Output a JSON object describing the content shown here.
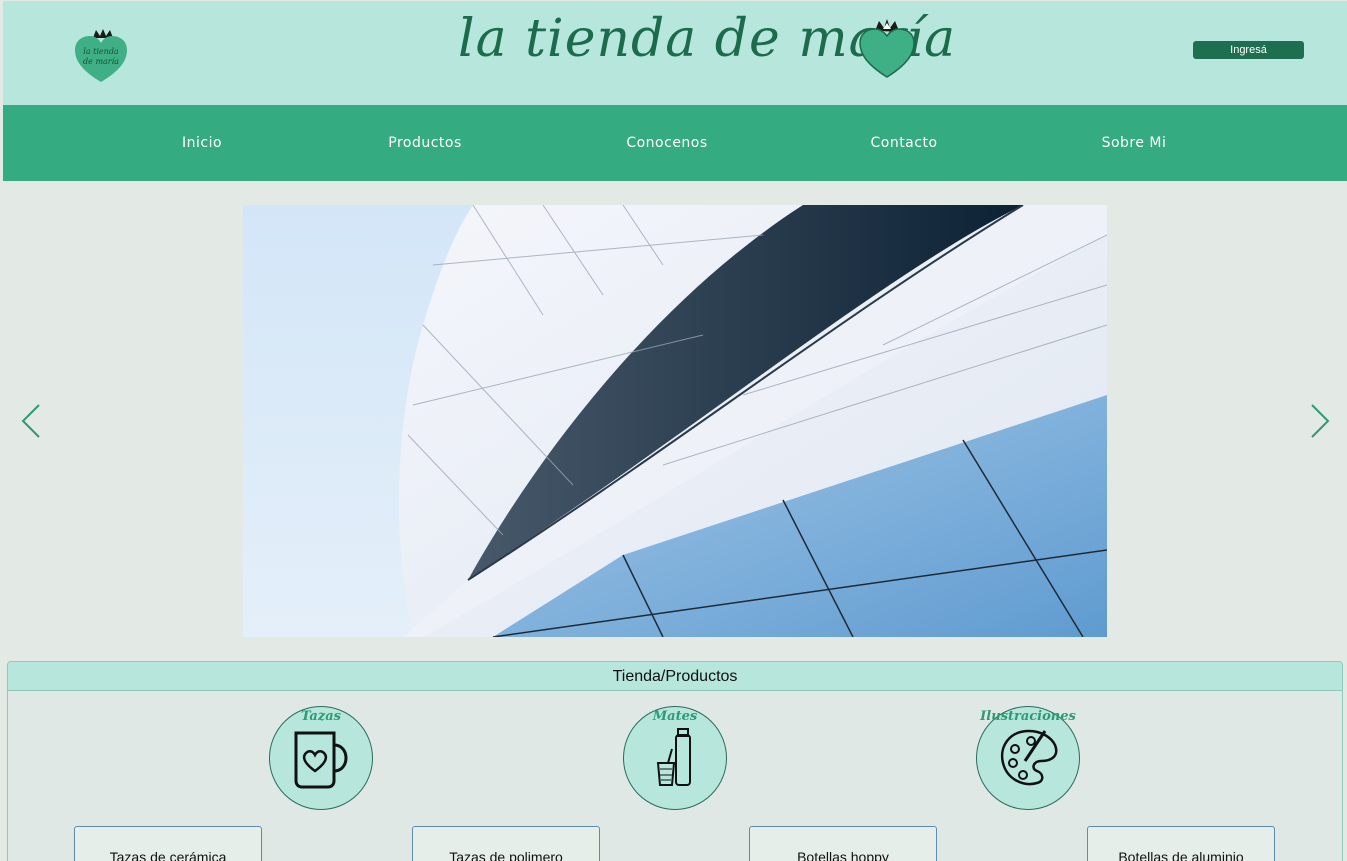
{
  "header": {
    "brand_name": "la tienda de maría",
    "small_logo_text": "la tienda de maría",
    "login_label": "Ingresá"
  },
  "nav": {
    "items": [
      {
        "label": "Inicio"
      },
      {
        "label": "Productos"
      },
      {
        "label": "Conocenos"
      },
      {
        "label": "Contacto"
      },
      {
        "label": "Sobre Mi"
      }
    ]
  },
  "carousel": {
    "prev_icon": "chevron-left-icon",
    "next_icon": "chevron-right-icon"
  },
  "products": {
    "title": "Tienda/Productos",
    "categories": [
      {
        "label": "Tazas",
        "icon": "mug-icon"
      },
      {
        "label": "Mates",
        "icon": "thermos-mate-icon"
      },
      {
        "label": "Ilustraciones",
        "icon": "palette-icon"
      }
    ],
    "cards": [
      {
        "label": "Tazas de cerámica"
      },
      {
        "label": "Tazas de polimero"
      },
      {
        "label": "Botellas hoppy"
      },
      {
        "label": "Botellas de aluminio"
      }
    ]
  },
  "colors": {
    "header_bg": "#b6e6dc",
    "nav_bg": "#34ab80",
    "brand": "#1b6b4c",
    "page_bg": "#e3e9e5"
  }
}
